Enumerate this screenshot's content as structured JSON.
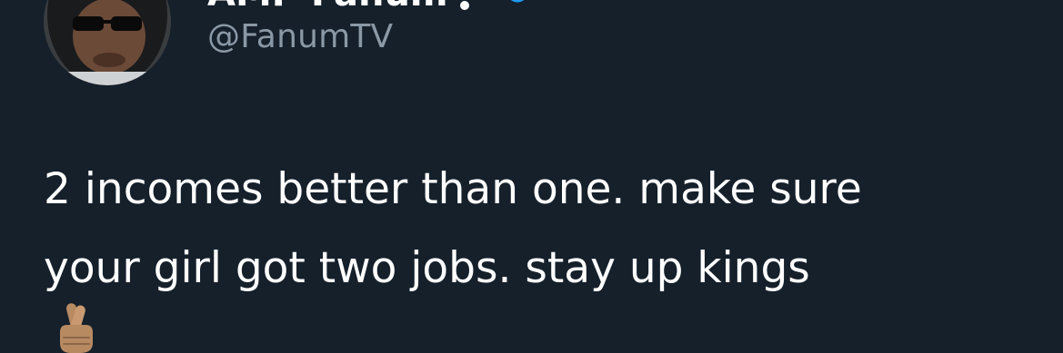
{
  "tweet": {
    "display_name": "AMP Fanum",
    "handle": "@FanumTV",
    "text_lines": [
      "2 incomes better than one. make sure",
      "your girl got two jobs. stay up kings"
    ],
    "emoji": "crossed-fingers-emoji"
  },
  "colors": {
    "background": "#15202b",
    "text": "#ffffff",
    "handle": "#8b98a5",
    "verified": "#1d9bf0"
  }
}
